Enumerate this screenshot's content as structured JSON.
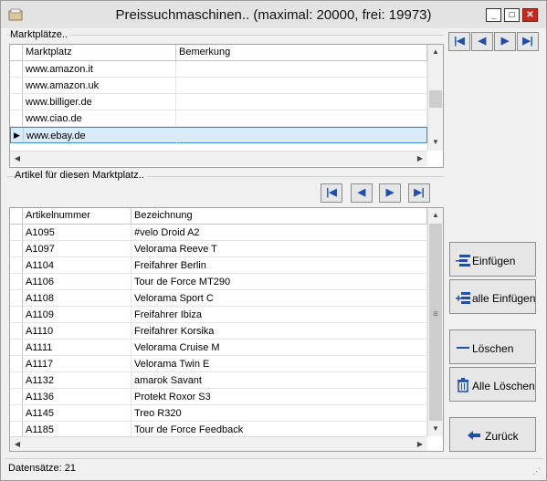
{
  "window": {
    "title": "Preissuchmaschinen.. (maximal: 20000, frei: 19973)"
  },
  "markets": {
    "group_label": "Marktplätze..",
    "columns": [
      "Marktplatz",
      "Bemerkung"
    ],
    "rows": [
      {
        "marketplace": "www.amazon.it",
        "note": ""
      },
      {
        "marketplace": "www.amazon.uk",
        "note": ""
      },
      {
        "marketplace": "www.billiger.de",
        "note": ""
      },
      {
        "marketplace": "www.ciao.de",
        "note": ""
      },
      {
        "marketplace": "www.ebay.de",
        "note": ""
      }
    ],
    "selected_index": 4
  },
  "articles": {
    "group_label": "Artikel für diesen Marktplatz..",
    "columns": [
      "Artikelnummer",
      "Bezeichnung"
    ],
    "rows": [
      {
        "number": "A1095",
        "name": "#velo Droid A2"
      },
      {
        "number": "A1097",
        "name": "Velorama Reeve T"
      },
      {
        "number": "A1104",
        "name": "Freifahrer Berlin"
      },
      {
        "number": "A1106",
        "name": "Tour de Force MT290"
      },
      {
        "number": "A1108",
        "name": "Velorama Sport C"
      },
      {
        "number": "A1109",
        "name": "Freifahrer Ibiza"
      },
      {
        "number": "A1110",
        "name": "Freifahrer Korsika"
      },
      {
        "number": "A1111",
        "name": "Velorama Cruise M"
      },
      {
        "number": "A1117",
        "name": "Velorama Twin E"
      },
      {
        "number": "A1132",
        "name": "amarok Savant"
      },
      {
        "number": "A1136",
        "name": "Protekt Roxor S3"
      },
      {
        "number": "A1145",
        "name": "Treo R320"
      },
      {
        "number": "A1185",
        "name": "Tour de Force Feedback"
      }
    ]
  },
  "nav": {
    "first": "|◀",
    "prev": "◀",
    "next": "▶",
    "last": "▶|"
  },
  "actions": {
    "insert": "Einfügen",
    "insert_all": "alle Einfügen",
    "delete": "Löschen",
    "delete_all": "Alle Löschen",
    "back": "Zurück"
  },
  "status": {
    "text": "Datensätze: 21"
  },
  "colors": {
    "selection": "#d9eaf8",
    "nav_arrow": "#1f4fa8",
    "close": "#c42b1c"
  }
}
